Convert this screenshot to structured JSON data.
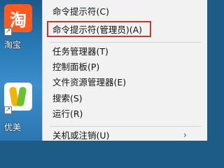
{
  "desktop": {
    "icons": [
      {
        "label": "淘宝",
        "glyph": "淘",
        "icon": "taobao-app-icon"
      },
      {
        "label": "优美",
        "icon": "youmei-app-icon"
      }
    ],
    "shortcut_glyph": "↗"
  },
  "menu": {
    "items": [
      {
        "label": "命令提示符(C)"
      },
      {
        "label": "命令提示符(管理员)(A)",
        "highlighted": true
      },
      {
        "label": "任务管理器(T)"
      },
      {
        "label": "控制面板(P)"
      },
      {
        "label": "文件资源管理器(E)"
      },
      {
        "label": "搜索(S)"
      },
      {
        "label": "运行(R)"
      },
      {
        "label": "关机或注销(U)",
        "submenu": true
      }
    ],
    "submenu_glyph": "›",
    "highlight_color": "#c9392b"
  }
}
